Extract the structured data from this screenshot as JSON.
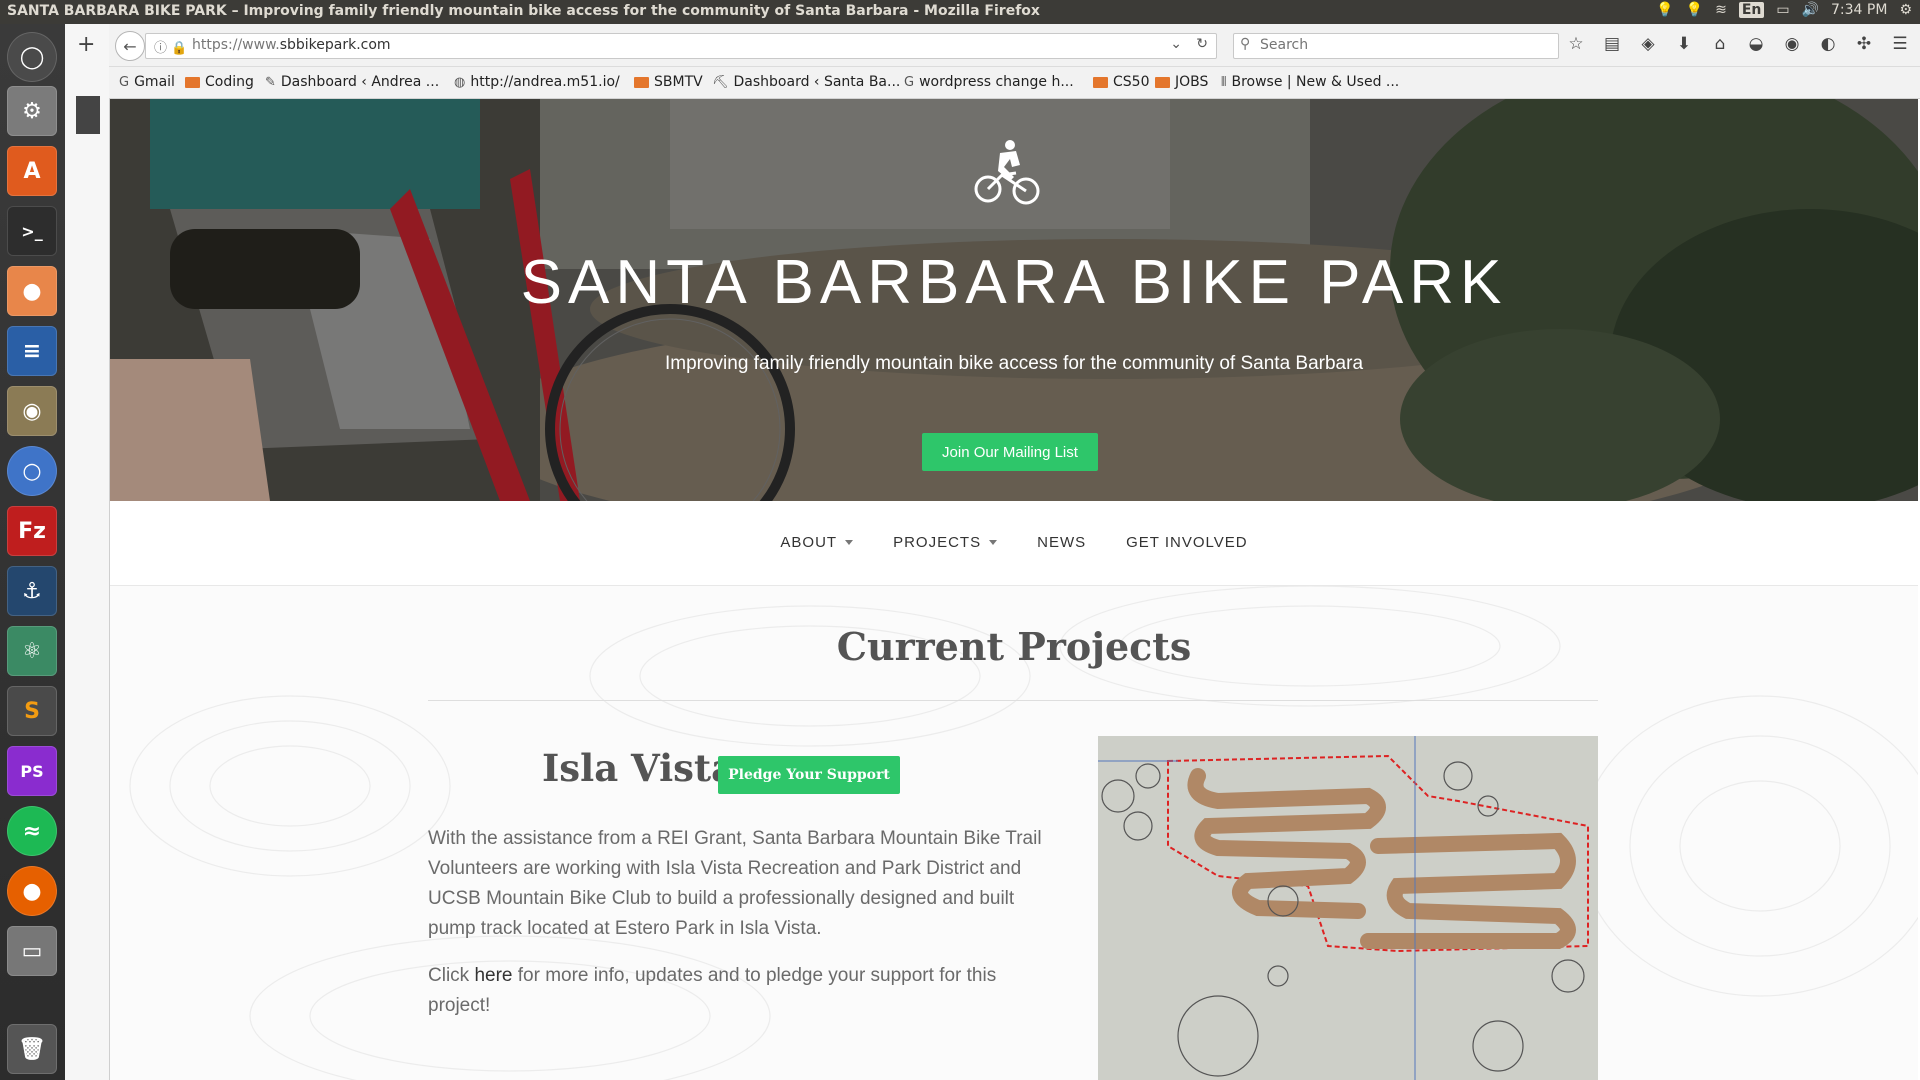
{
  "os": {
    "window_title": "SANTA BARBARA BIKE PARK – Improving family friendly mountain bike access for the community of Santa Barbara - Mozilla Firefox",
    "keyboard_layout": "En",
    "clock": "7:34 PM"
  },
  "launcher": {
    "items": [
      "ubuntu-dash-icon",
      "system-settings-icon",
      "software-center-icon",
      "terminal-icon",
      "idea-icon",
      "writer-icon",
      "gimp-icon",
      "chromium-icon",
      "filezilla-icon",
      "mysql-workbench-icon",
      "atom-icon",
      "sublime-text-icon",
      "phpstorm-icon",
      "spotify-icon",
      "firefox-icon",
      "files-icon",
      "trash-icon"
    ]
  },
  "browser": {
    "url_protocol": "https://www.",
    "url_host": "sbbikepark.com",
    "search_placeholder": "Search",
    "new_tab_label": "+"
  },
  "bookmarks": [
    {
      "label": "Gmail",
      "icon": "google-icon"
    },
    {
      "label": "Coding",
      "icon": "folder-icon"
    },
    {
      "label": "Dashboard ‹ Andrea ...",
      "icon": "bookmark-icon"
    },
    {
      "label": "http://andrea.m51.io/",
      "icon": "globe-icon"
    },
    {
      "label": "SBMTV",
      "icon": "folder-icon"
    },
    {
      "label": "Dashboard ‹ Santa Ba...",
      "icon": "bookmark-icon"
    },
    {
      "label": "wordpress change h...",
      "icon": "google-icon"
    },
    {
      "label": "CS50",
      "icon": "folder-icon"
    },
    {
      "label": "JOBS",
      "icon": "folder-icon"
    },
    {
      "label": "Browse | New & Used ...",
      "icon": "bookmark-icon"
    }
  ],
  "hero": {
    "title": "SANTA BARBARA BIKE PARK",
    "subtitle": "Improving family friendly mountain bike access for the community of Santa Barbara",
    "cta_label": "Join Our Mailing List"
  },
  "nav": {
    "about": "ABOUT",
    "projects": "PROJECTS",
    "news": "NEWS",
    "get_involved": "GET INVOLVED"
  },
  "content": {
    "section_title": "Current Projects",
    "project_title": "Isla Vista",
    "pledge_label": "Pledge Your Support",
    "project_body": "With the assistance from a REI Grant, Santa Barbara Mountain Bike Trail Volunteers are working with Isla Vista Recreation and Park District and UCSB Mountain Bike Club to build a professionally designed and built pump track located at Estero Park in Isla Vista.",
    "more_prefix": "Click ",
    "more_link": "here",
    "more_suffix": " for more info, updates and to pledge your support for this project!"
  },
  "colors": {
    "accent_green": "#2ec66a",
    "heading_gray": "#545454",
    "body_gray": "#6a6a6a"
  }
}
